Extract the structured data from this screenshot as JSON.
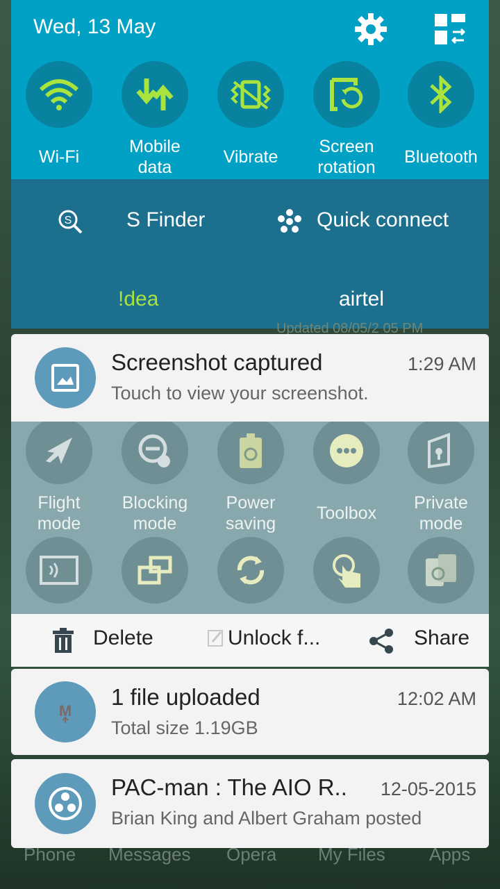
{
  "status": {
    "date": "Wed, 13 May"
  },
  "quick_tiles": [
    {
      "label_line1": "Wi-Fi",
      "label_line2": "",
      "icon": "wifi-icon"
    },
    {
      "label_line1": "Mobile",
      "label_line2": "data",
      "icon": "mobile-data-icon"
    },
    {
      "label_line1": "Vibrate",
      "label_line2": "",
      "icon": "vibrate-icon"
    },
    {
      "label_line1": "Screen",
      "label_line2": "rotation",
      "icon": "screen-rotation-icon"
    },
    {
      "label_line1": "Bluetooth",
      "label_line2": "",
      "icon": "bluetooth-icon"
    }
  ],
  "sfinder": {
    "label": "S Finder"
  },
  "quick_connect": {
    "label": "Quick connect"
  },
  "carriers": [
    "!dea",
    "airtel"
  ],
  "background_text": "Updated 08/05/2 05 PM",
  "notifications": {
    "screenshot": {
      "title": "Screenshot captured",
      "time": "1:29 AM",
      "subtitle": "Touch to view your screenshot."
    },
    "upload": {
      "title": "1 file uploaded",
      "time": "12:02 AM",
      "subtitle": "Total size 1.19GB"
    },
    "pacman": {
      "title": "PAC-man : The AIO R..",
      "time": "12-05-2015",
      "subtitle": "Brian King and Albert Graham posted"
    }
  },
  "preview_tiles_row1": [
    {
      "line1": "Flight",
      "line2": "mode"
    },
    {
      "line1": "Blocking",
      "line2": "mode"
    },
    {
      "line1": "Power",
      "line2": "saving"
    },
    {
      "line1": "Toolbox",
      "line2": ""
    },
    {
      "line1": "Private",
      "line2": "mode"
    }
  ],
  "actions": {
    "delete": "Delete",
    "unlock": "Unlock f...",
    "share": "Share"
  },
  "dock": [
    "Phone",
    "Messages",
    "Opera",
    "My Files",
    "Apps"
  ],
  "colors": {
    "panel": "#00a1c4",
    "tile_circle": "#08829f",
    "icon_active": "#a9e33e",
    "sfinder_bar": "#1d6f8e"
  }
}
